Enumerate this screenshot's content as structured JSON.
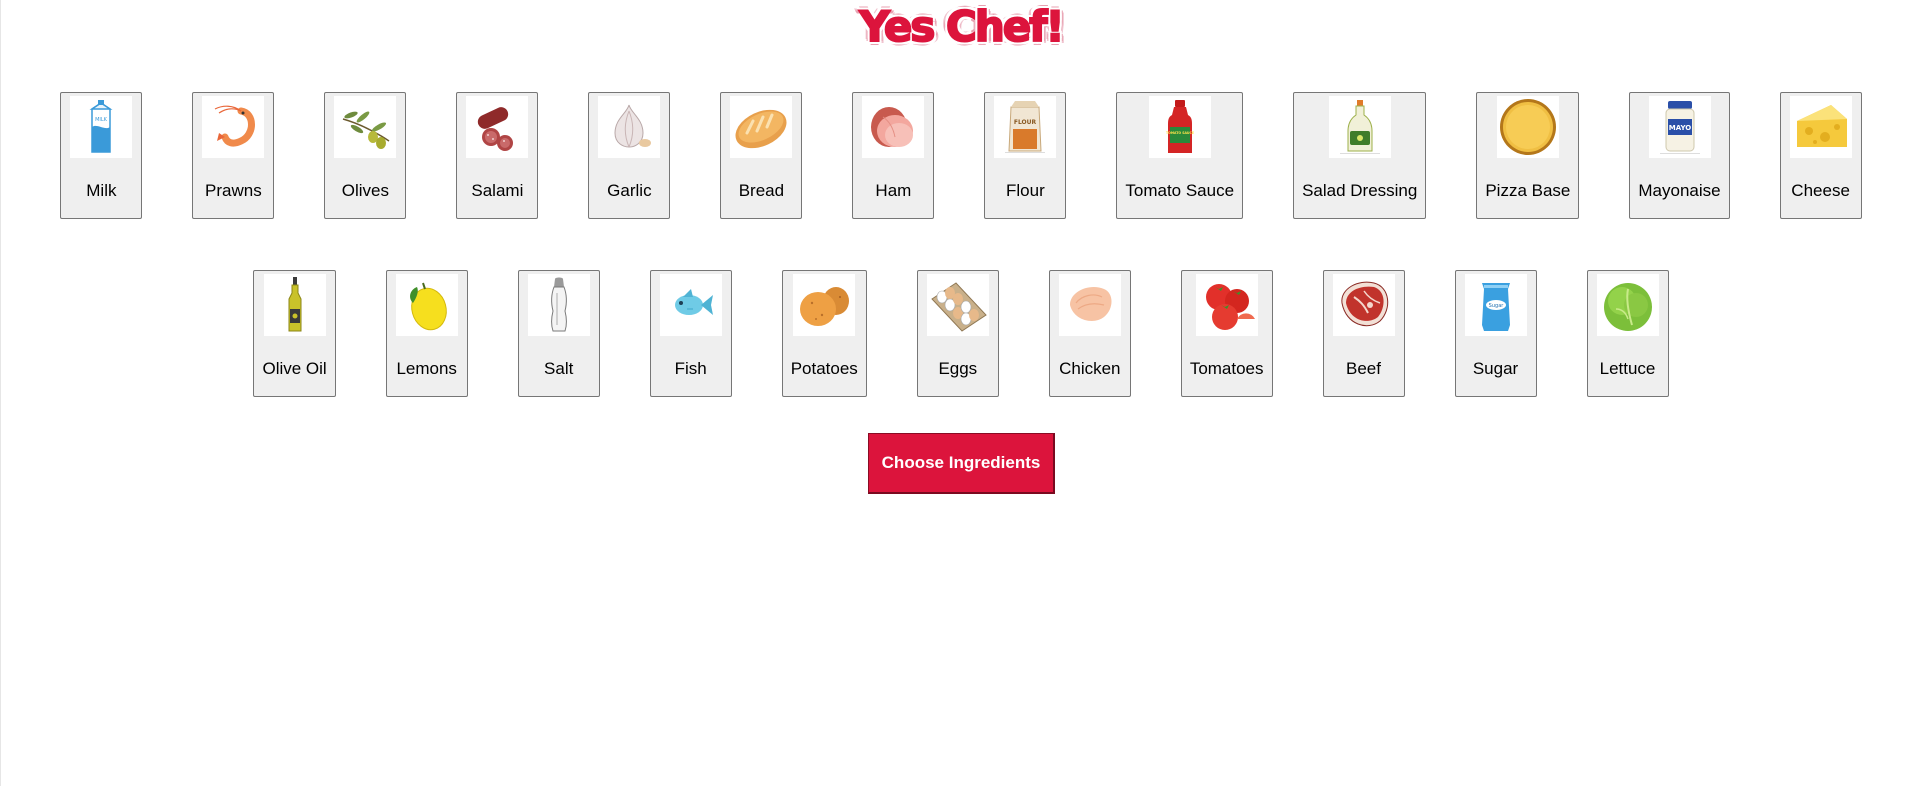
{
  "app": {
    "logo_text": "Yes Chef!"
  },
  "ingredients_row_1": [
    {
      "label": "Milk",
      "icon": "milk-carton-icon"
    },
    {
      "label": "Prawns",
      "icon": "prawn-icon"
    },
    {
      "label": "Olives",
      "icon": "olive-branch-icon"
    },
    {
      "label": "Salami",
      "icon": "salami-icon"
    },
    {
      "label": "Garlic",
      "icon": "garlic-icon"
    },
    {
      "label": "Bread",
      "icon": "bread-loaf-icon"
    },
    {
      "label": "Ham",
      "icon": "ham-icon"
    },
    {
      "label": "Flour",
      "icon": "flour-bag-icon"
    },
    {
      "label": "Tomato Sauce",
      "icon": "tomato-sauce-bottle-icon"
    },
    {
      "label": "Salad Dressing",
      "icon": "salad-dressing-bottle-icon"
    },
    {
      "label": "Pizza Base",
      "icon": "pizza-base-icon"
    },
    {
      "label": "Mayonaise",
      "icon": "mayo-jar-icon"
    },
    {
      "label": "Cheese",
      "icon": "cheese-wedge-icon"
    }
  ],
  "ingredients_row_2": [
    {
      "label": "Olive Oil",
      "icon": "olive-oil-bottle-icon"
    },
    {
      "label": "Lemons",
      "icon": "lemon-icon"
    },
    {
      "label": "Salt",
      "icon": "salt-shaker-icon"
    },
    {
      "label": "Fish",
      "icon": "fish-icon"
    },
    {
      "label": "Potatoes",
      "icon": "potatoes-icon"
    },
    {
      "label": "Eggs",
      "icon": "egg-carton-icon"
    },
    {
      "label": "Chicken",
      "icon": "chicken-breast-icon"
    },
    {
      "label": "Tomatoes",
      "icon": "tomatoes-icon"
    },
    {
      "label": "Beef",
      "icon": "beef-steak-icon"
    },
    {
      "label": "Sugar",
      "icon": "sugar-bag-icon"
    },
    {
      "label": "Lettuce",
      "icon": "lettuce-icon"
    }
  ],
  "icon_text": {
    "milk": "MILK",
    "flour": "FLOUR",
    "tomato_sauce": "TOMATO SAUCE",
    "mayo": "MAYO",
    "sugar": "Sugar"
  },
  "actions": {
    "submit_label": "Choose Ingredients"
  },
  "colors": {
    "brand": "#dc143c",
    "card_bg": "#efefef",
    "card_border": "#767676"
  }
}
